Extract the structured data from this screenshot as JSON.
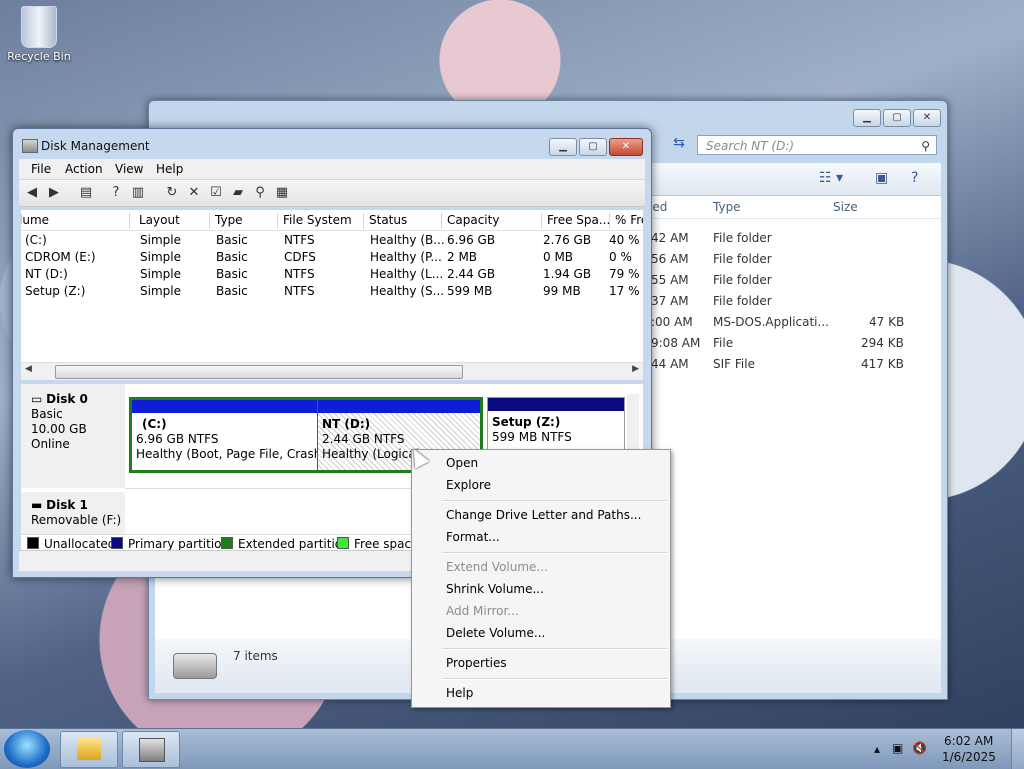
{
  "desktop": {
    "recycle_bin_label": "Recycle Bin"
  },
  "explorer": {
    "search_placeholder": "Search NT (D:)",
    "columns": {
      "modified": "ied",
      "type": "Type",
      "size": "Size"
    },
    "rows": [
      {
        "time": "42 AM",
        "type": "File folder",
        "size": ""
      },
      {
        "time": "56 AM",
        "type": "File folder",
        "size": ""
      },
      {
        "time": "55 AM",
        "type": "File folder",
        "size": ""
      },
      {
        "time": "37 AM",
        "type": "File folder",
        "size": ""
      },
      {
        "time": ":00 AM",
        "type": "MS-DOS.Applicati...",
        "size": "47 KB"
      },
      {
        "time": "9:08 AM",
        "type": "File",
        "size": "294 KB"
      },
      {
        "time": "44 AM",
        "type": "SIF File",
        "size": "417 KB"
      }
    ],
    "status_count": "7 items"
  },
  "disk_management": {
    "title": "Disk Management",
    "menu": [
      "File",
      "Action",
      "View",
      "Help"
    ],
    "columns": [
      "lume",
      "Layout",
      "Type",
      "File System",
      "Status",
      "Capacity",
      "Free Spa...",
      "% Free"
    ],
    "volumes": [
      [
        "(C:)",
        "Simple",
        "Basic",
        "NTFS",
        "Healthy (B...",
        "6.96 GB",
        "2.76 GB",
        "40 %"
      ],
      [
        "CDROM (E:)",
        "Simple",
        "Basic",
        "CDFS",
        "Healthy (P...",
        "2 MB",
        "0 MB",
        "0 %"
      ],
      [
        "NT (D:)",
        "Simple",
        "Basic",
        "NTFS",
        "Healthy (L...",
        "2.44 GB",
        "1.94 GB",
        "79 %"
      ],
      [
        "Setup (Z:)",
        "Simple",
        "Basic",
        "NTFS",
        "Healthy (S...",
        "599 MB",
        "99 MB",
        "17 %"
      ]
    ],
    "disk0": {
      "name": "Disk 0",
      "type": "Basic",
      "size": "10.00 GB",
      "state": "Online"
    },
    "disk1": {
      "name": "Disk 1",
      "type": "Removable (F:)"
    },
    "partitions": [
      {
        "name": "(C:)",
        "size": "6.96 GB NTFS",
        "status": "Healthy (Boot, Page File, Crash D"
      },
      {
        "name": "NT  (D:)",
        "size": "2.44 GB NTFS",
        "status": "Healthy (Logical"
      },
      {
        "name": "Setup  (Z:)",
        "size": "599 MB NTFS",
        "status": ""
      }
    ],
    "legend": [
      "Unallocated",
      "Primary partition",
      "Extended partition",
      "Free space"
    ],
    "colors": {
      "unallocated": "#000000",
      "primary": "#0e1ed8",
      "extended": "#1d7d1d",
      "free": "#3ee63e"
    }
  },
  "context_menu": {
    "open": "Open",
    "explore": "Explore",
    "change_letter": "Change Drive Letter and Paths...",
    "format": "Format...",
    "extend": "Extend Volume...",
    "shrink": "Shrink Volume...",
    "add_mirror": "Add Mirror...",
    "delete": "Delete Volume...",
    "properties": "Properties",
    "help": "Help"
  },
  "taskbar": {
    "time": "6:02 AM",
    "date": "1/6/2025"
  }
}
